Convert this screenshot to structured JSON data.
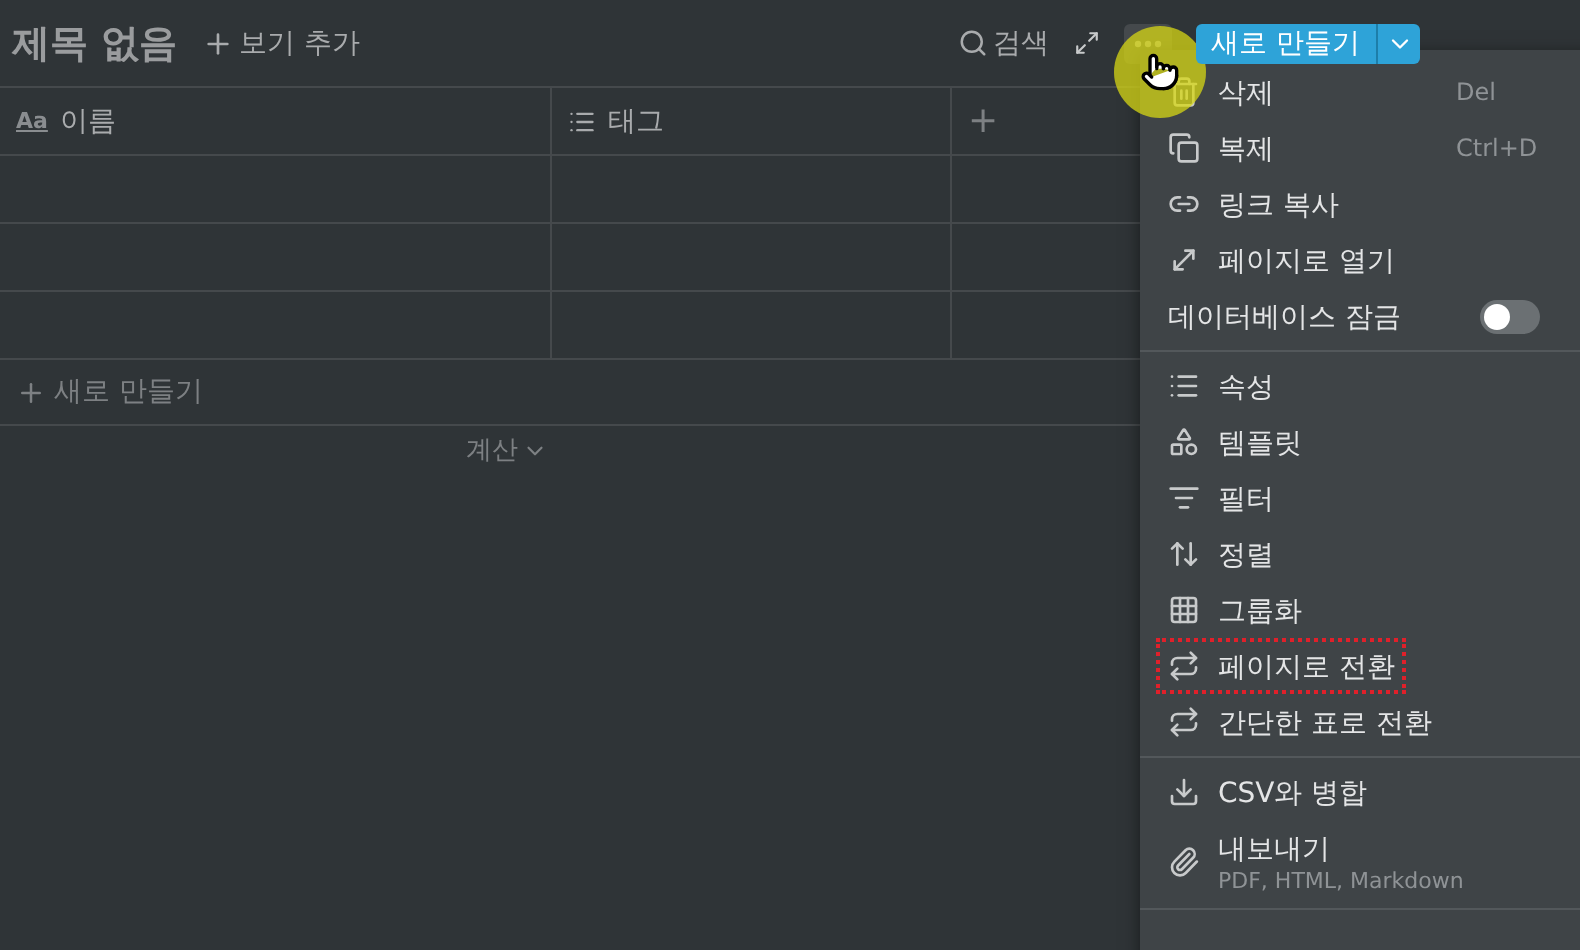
{
  "title": "제목 없음",
  "add_view": "보기 추가",
  "toolbar": {
    "search": "검색",
    "new_button": "새로 만들기"
  },
  "table": {
    "columns": [
      {
        "label": "이름",
        "kind": "text",
        "type_mark": "Aa"
      },
      {
        "label": "태그",
        "kind": "list"
      }
    ],
    "add_column": "+",
    "new_row": "새로 만들기",
    "calculate": "계산"
  },
  "menu": {
    "sections": [
      [
        {
          "kind": "action",
          "label": "삭제",
          "shortcut": "Del"
        },
        {
          "kind": "action",
          "label": "복제",
          "shortcut": "Ctrl+D"
        },
        {
          "kind": "action",
          "label": "링크 복사"
        },
        {
          "kind": "action",
          "label": "페이지로 열기"
        },
        {
          "kind": "toggle",
          "label": "데이터베이스 잠금",
          "on": false
        }
      ],
      [
        {
          "kind": "action",
          "label": "속성"
        },
        {
          "kind": "action",
          "label": "템플릿"
        },
        {
          "kind": "action",
          "label": "필터"
        },
        {
          "kind": "action",
          "label": "정렬"
        },
        {
          "kind": "action",
          "label": "그룹화"
        },
        {
          "kind": "action",
          "label": "페이지로 전환",
          "outlined": true
        },
        {
          "kind": "action",
          "label": "간단한 표로 전환",
          "outlined": false
        }
      ],
      [
        {
          "kind": "action",
          "label": "CSV와 병합"
        },
        {
          "kind": "action",
          "label": "내보내기",
          "note": "PDF, HTML, Markdown"
        }
      ]
    ]
  }
}
